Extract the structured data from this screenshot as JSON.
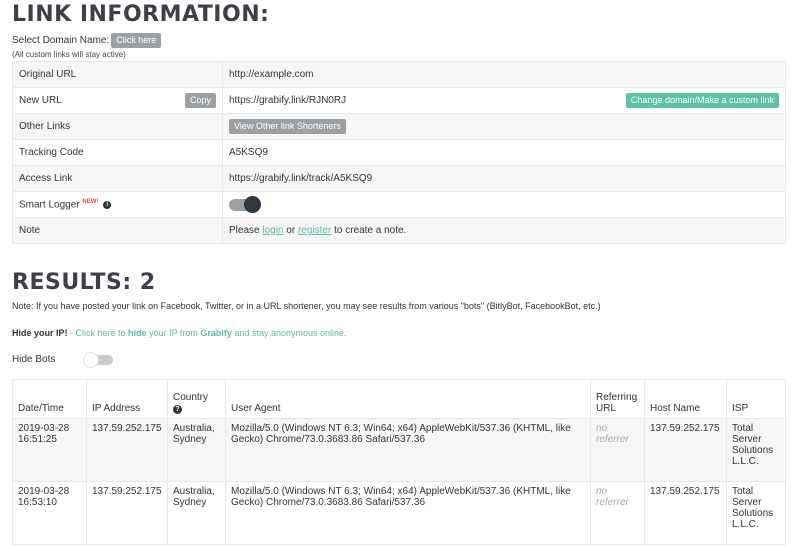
{
  "link_info": {
    "title": "LINK INFORMATION:",
    "select_domain_label": "Select Domain Name:",
    "click_here_label": "Click here",
    "domain_note": "(All custom links will stay active)",
    "rows": {
      "original_url": {
        "label": "Original URL",
        "value": "http://example.com"
      },
      "new_url": {
        "label": "New URL",
        "copy_label": "Copy",
        "value": "https://grabify.link/RJN0RJ",
        "change_domain_label": "Change domain/Make a custom link"
      },
      "other_links": {
        "label": "Other Links",
        "button_label": "View Other link Shorteners"
      },
      "tracking_code": {
        "label": "Tracking Code",
        "value": "A5KSQ9"
      },
      "access_link": {
        "label": "Access Link",
        "value": "https://grabify.link/track/A5KSQ9"
      },
      "smart_logger": {
        "label": "Smart Logger",
        "badge": "NEW!",
        "info_icon": "i",
        "enabled": true
      },
      "note": {
        "label": "Note",
        "text_before": "Please ",
        "login": "login",
        "or": " or ",
        "register": "register",
        "text_after": " to create a note."
      }
    }
  },
  "results": {
    "title": "RESULTS: 2",
    "note": "Note: If you have posted your link on Facebook, Twitter, or in a URL shortener, you may see results from various \"bots\" (BitlyBot, FacebookBot, etc.)",
    "hide_ip": {
      "label": "Hide your IP!",
      "dash": " - Click here to ",
      "hide": "hide",
      "mid": " your IP from ",
      "grabify": "Grabify",
      "end": " and stay anonymous online."
    },
    "hide_bots_label": "Hide Bots",
    "hide_bots_enabled": false,
    "columns": [
      "Date/Time",
      "IP Address",
      "Country",
      "User Agent",
      "Referring URL",
      "Host Name",
      "ISP"
    ],
    "rows": [
      {
        "datetime": "2019-03-28 16:51:25",
        "ip": "137.59.252.175",
        "country": "Australia, Sydney",
        "user_agent": "Mozilla/5.0 (Windows NT 6.3; Win64; x64) AppleWebKit/537.36 (KHTML, like Gecko) Chrome/73.0.3683.86 Safari/537.36",
        "referrer": "no referrer",
        "host": "137.59.252.175",
        "isp": "Total Server Solutions L.L.C."
      },
      {
        "datetime": "2019-03-28 16:53:10",
        "ip": "137.59.252.175",
        "country": "Australia, Sydney",
        "user_agent": "Mozilla/5.0 (Windows NT 6.3; Win64; x64) AppleWebKit/537.36 (KHTML, like Gecko) Chrome/73.0.3683.86 Safari/537.36",
        "referrer": "no referrer",
        "host": "137.59.252.175",
        "isp": "Total Server Solutions L.L.C."
      }
    ]
  },
  "colors": {
    "accent": "#5cc1a8",
    "button_grey": "#9aa0a3",
    "title": "#3d4147"
  }
}
